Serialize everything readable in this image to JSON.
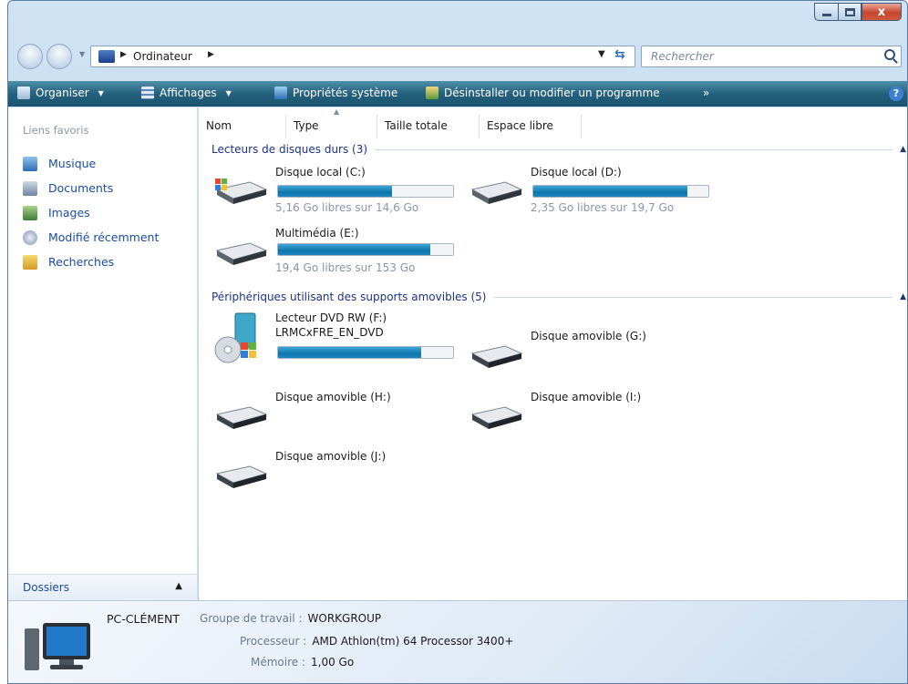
{
  "window": {
    "accent": "#24617c",
    "close_glyph": "x"
  },
  "address": {
    "path": "Ordinateur",
    "search_placeholder": "Rechercher"
  },
  "toolbar": {
    "organize": "Organiser",
    "views": "Affichages",
    "system_properties": "Propriétés système",
    "uninstall": "Désinstaller ou modifier un programme",
    "more": "»",
    "help": "?"
  },
  "sidebar": {
    "favorites_header": "Liens favoris",
    "items": [
      {
        "label": "Musique",
        "icon": "music-icon"
      },
      {
        "label": "Documents",
        "icon": "documents-icon"
      },
      {
        "label": "Images",
        "icon": "images-icon"
      },
      {
        "label": "Modifié récemment",
        "icon": "recent-icon"
      },
      {
        "label": "Recherches",
        "icon": "searches-icon"
      }
    ],
    "folders_label": "Dossiers"
  },
  "columns": [
    "Nom",
    "Type",
    "Taille totale",
    "Espace libre"
  ],
  "groups": {
    "hard_drives": {
      "title": "Lecteurs de disques durs (3)",
      "drives": [
        {
          "name": "Disque local (C:)",
          "free_text": "5,16 Go libres sur 14,6 Go",
          "used_fraction": 0.65
        },
        {
          "name": "Disque local (D:)",
          "free_text": "2,35 Go libres sur 19,7 Go",
          "used_fraction": 0.88
        },
        {
          "name": "Multimédia (E:)",
          "free_text": "19,4 Go libres sur 153 Go",
          "used_fraction": 0.87
        }
      ]
    },
    "removable": {
      "title": "Périphériques utilisant des supports amovibles (5)",
      "dvd": {
        "name": "Lecteur DVD RW (F:)",
        "label": "LRMCxFRE_EN_DVD",
        "used_fraction": 0.82
      },
      "drives": [
        {
          "name": "Disque amovible (G:)"
        },
        {
          "name": "Disque amovible (H:)"
        },
        {
          "name": "Disque amovible (I:)"
        },
        {
          "name": "Disque amovible (J:)"
        }
      ]
    }
  },
  "details": {
    "computer_name": "PC-CLÉMENT",
    "workgroup_label": "Groupe de travail :",
    "workgroup_value": "WORKGROUP",
    "processor_label": "Processeur :",
    "processor_value": "AMD Athlon(tm) 64 Processor 3400+",
    "memory_label": "Mémoire :",
    "memory_value": "1,00 Go"
  }
}
